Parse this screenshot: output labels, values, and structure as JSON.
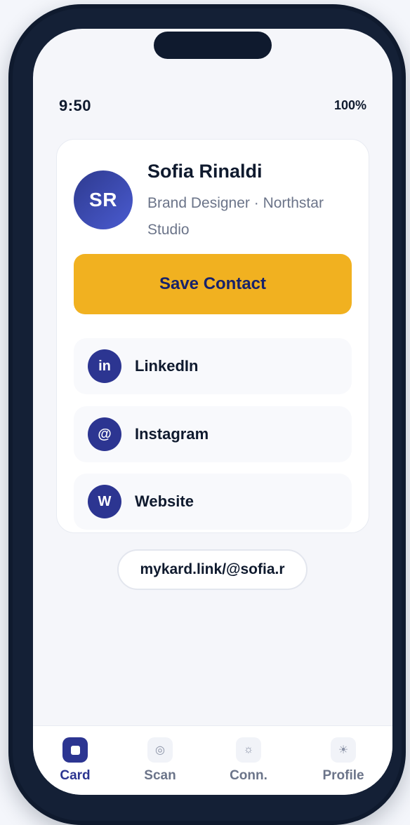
{
  "status_bar": {
    "time": "9:50",
    "battery": "100%"
  },
  "profile": {
    "initials": "SR",
    "name": "Sofia Rinaldi",
    "role": "Brand Designer · Northstar Studio"
  },
  "actions": {
    "save_label": "Save Contact"
  },
  "links": [
    {
      "badge": "in",
      "label": "LinkedIn",
      "icon": "linkedin-icon"
    },
    {
      "badge": "@",
      "label": "Instagram",
      "icon": "instagram-icon"
    },
    {
      "badge": "W",
      "label": "Website",
      "icon": "website-icon"
    }
  ],
  "share_url": "mykard.link/@sofia.r",
  "tabbar": {
    "active": "Card",
    "items": [
      {
        "label": "Card",
        "icon": "card-icon",
        "glyph": ""
      },
      {
        "label": "Scan",
        "icon": "scan-icon",
        "glyph": "◎"
      },
      {
        "label": "Conn.",
        "icon": "connections-icon",
        "glyph": "☼"
      },
      {
        "label": "Profile",
        "icon": "profile-icon",
        "glyph": "☀"
      }
    ]
  },
  "colors": {
    "accent": "#2c3591",
    "save_button": "#f1b120",
    "frame": "#0f1a2e"
  }
}
